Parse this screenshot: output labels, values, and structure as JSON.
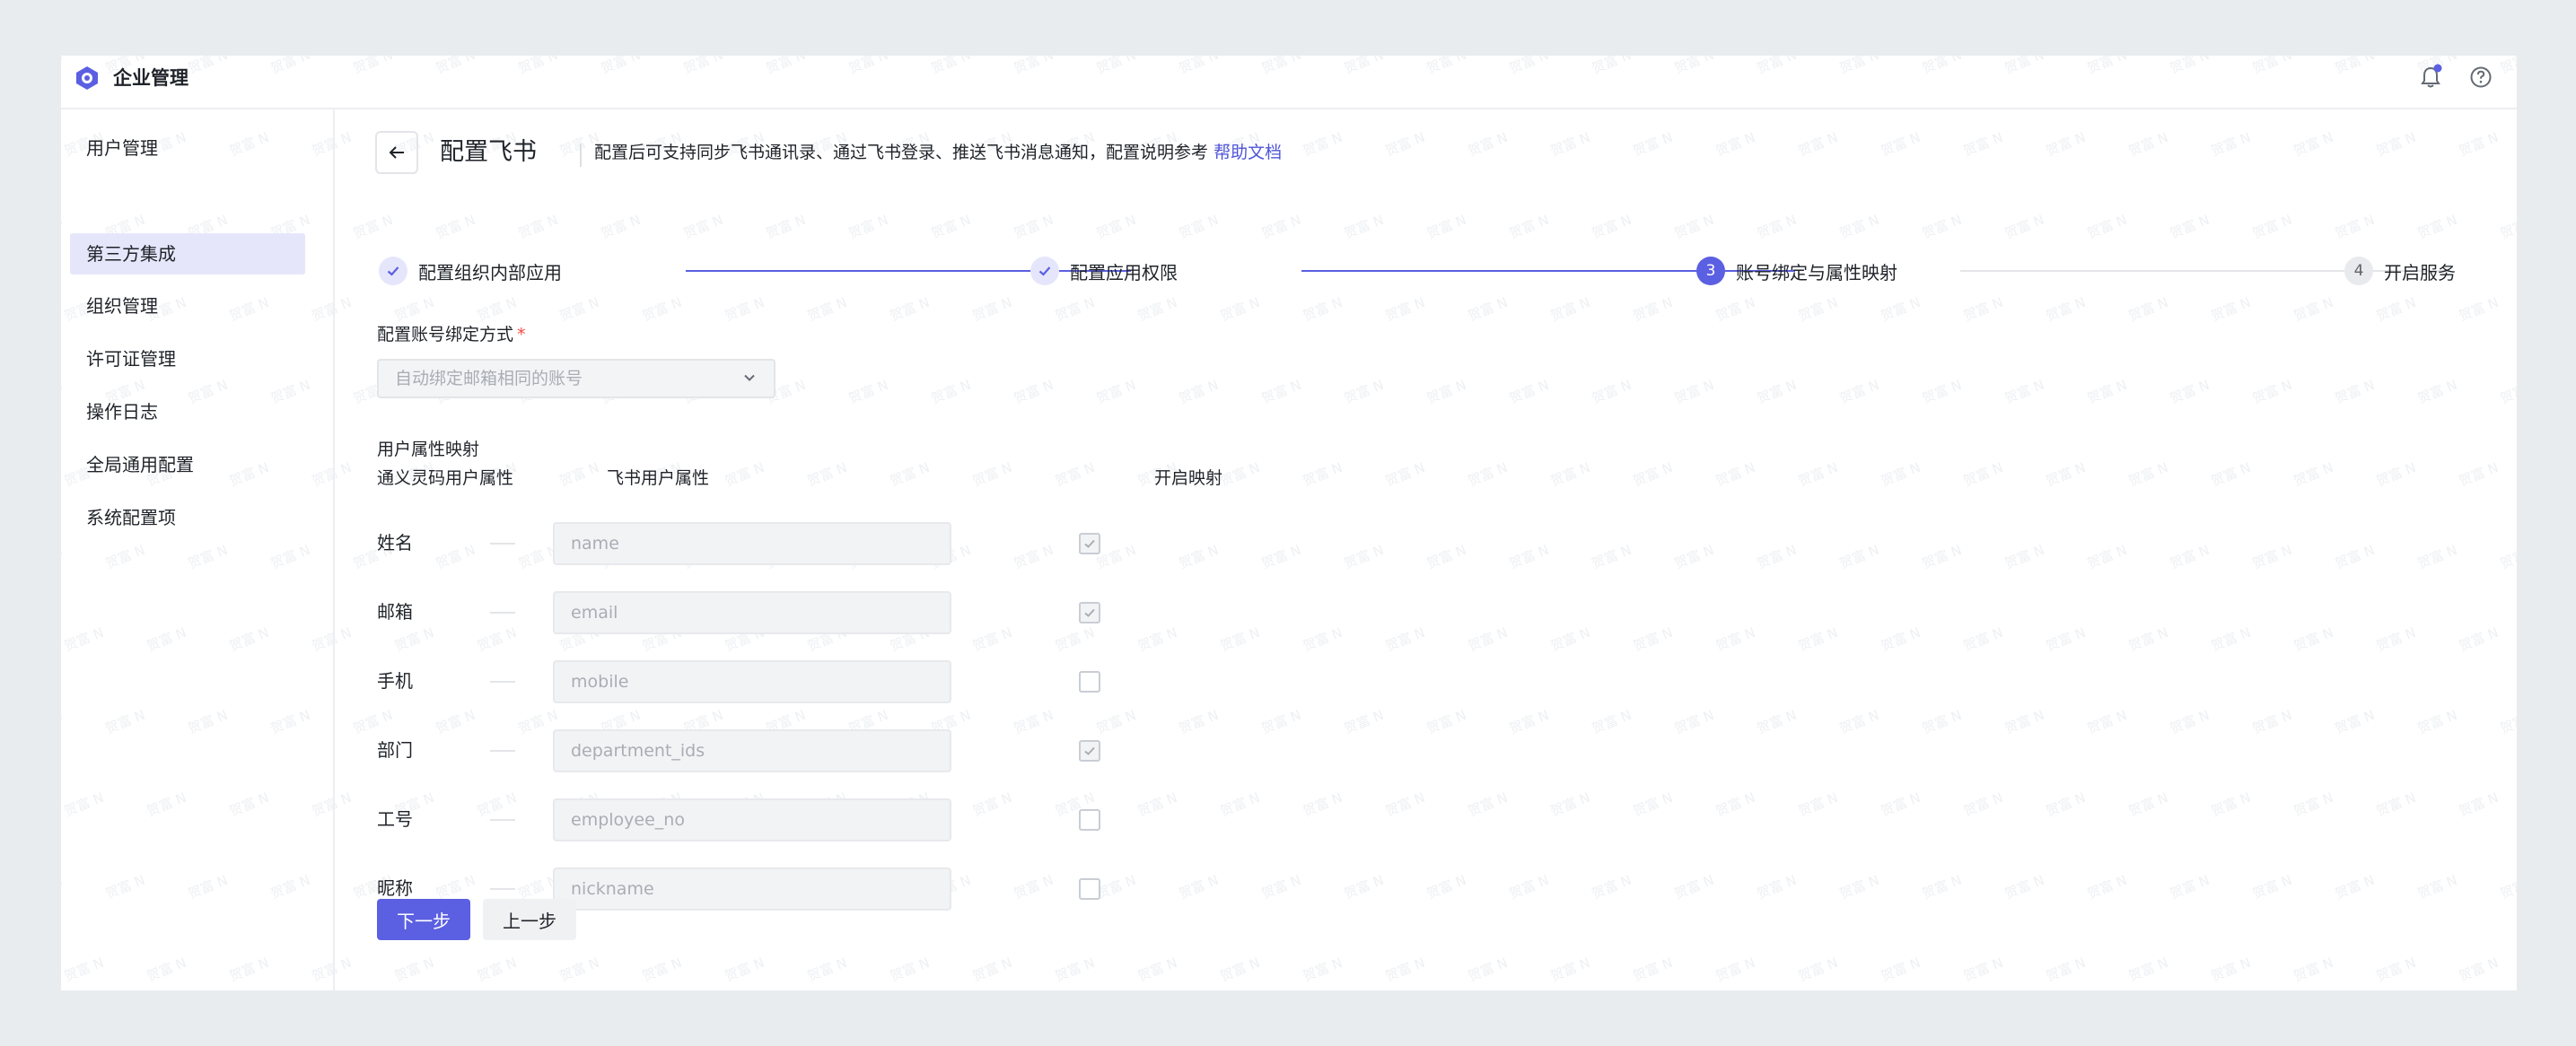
{
  "app": {
    "title": "企业管理",
    "watermark_text": "贺富 N"
  },
  "colors": {
    "accent": "#5b5fe1",
    "link": "#4e54d8",
    "required": "#f54a45",
    "nav_active_bg": "#e6e6fb"
  },
  "topbar": {
    "bell_icon": "bell-icon",
    "help_icon": "help-circle-icon",
    "has_notification_dot": true
  },
  "sidebar": {
    "items": [
      {
        "label": "用户管理",
        "active": false
      },
      {
        "label": "第三方集成",
        "active": true
      },
      {
        "label": "组织管理",
        "active": false
      },
      {
        "label": "许可证管理",
        "active": false
      },
      {
        "label": "操作日志",
        "active": false
      },
      {
        "label": "全局通用配置",
        "active": false
      },
      {
        "label": "系统配置项",
        "active": false
      }
    ]
  },
  "header": {
    "back_icon": "arrow-left-icon",
    "title": "配置飞书",
    "description": "配置后可支持同步飞书通讯录、通过飞书登录、推送飞书消息通知，配置说明参考",
    "help_link": "帮助文档"
  },
  "steps": [
    {
      "index": "1",
      "label": "配置组织内部应用",
      "status": "done"
    },
    {
      "index": "2",
      "label": "配置应用权限",
      "status": "done"
    },
    {
      "index": "3",
      "label": "账号绑定与属性映射",
      "status": "current"
    },
    {
      "index": "4",
      "label": "开启服务",
      "status": "todo"
    }
  ],
  "binding": {
    "label": "配置账号绑定方式",
    "required_mark": "*",
    "selected": "自动绑定邮箱相同的账号"
  },
  "mapping": {
    "section_title": "用户属性映射",
    "col_local": "通义灵码用户属性",
    "col_feishu": "飞书用户属性",
    "col_enable": "开启映射",
    "rows": [
      {
        "label": "姓名",
        "attr": "name",
        "checked": true
      },
      {
        "label": "邮箱",
        "attr": "email",
        "checked": true
      },
      {
        "label": "手机",
        "attr": "mobile",
        "checked": false
      },
      {
        "label": "部门",
        "attr": "department_ids",
        "checked": true
      },
      {
        "label": "工号",
        "attr": "employee_no",
        "checked": false
      },
      {
        "label": "昵称",
        "attr": "nickname",
        "checked": false
      }
    ]
  },
  "actions": {
    "next": "下一步",
    "prev": "上一步"
  }
}
